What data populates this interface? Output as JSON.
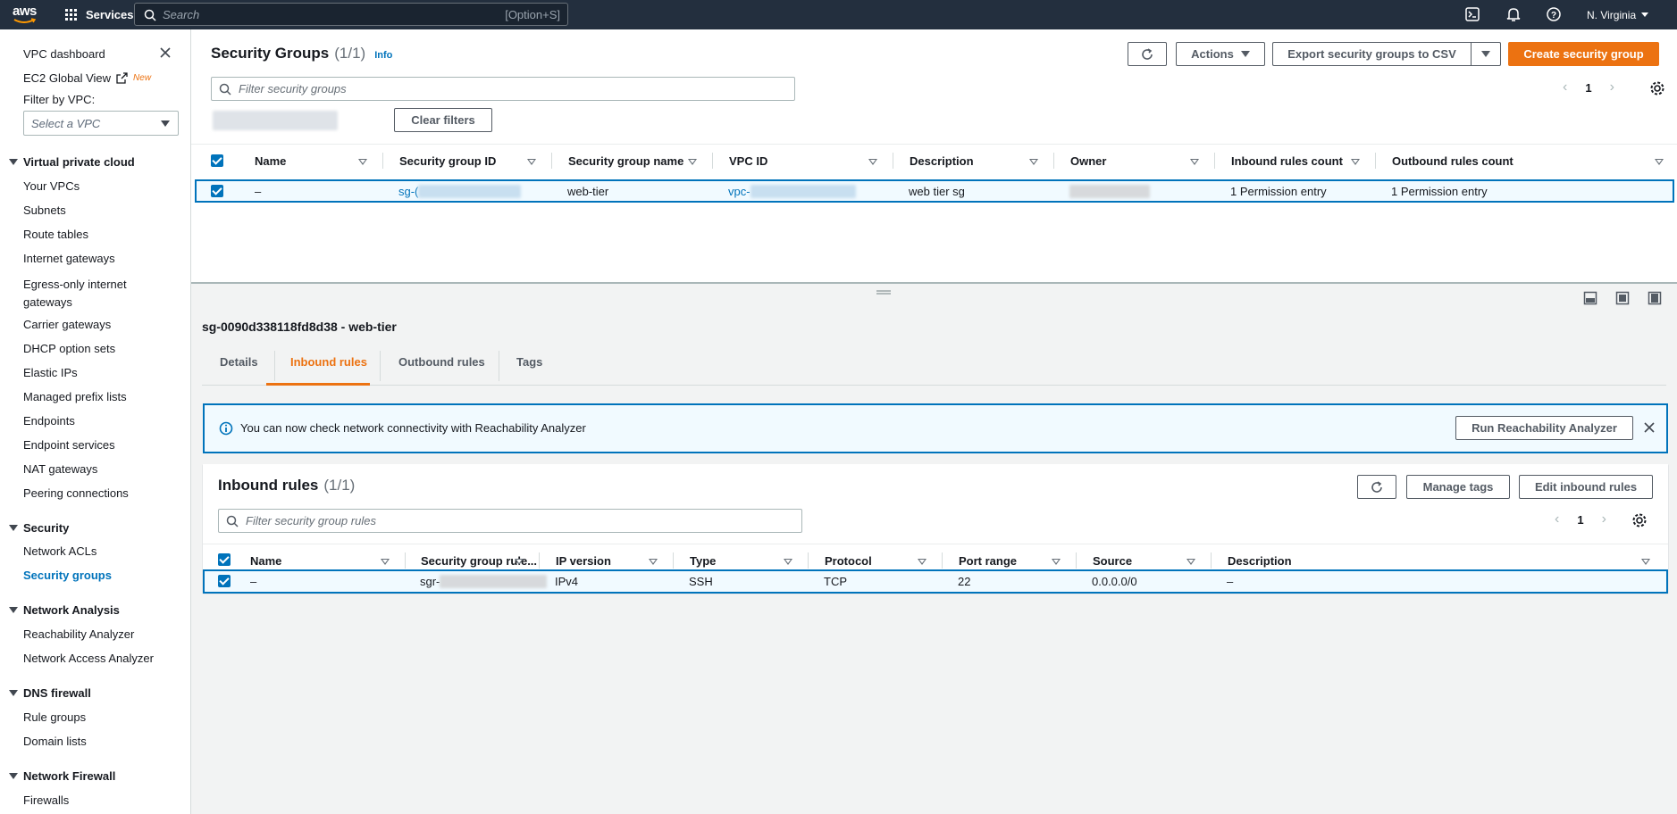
{
  "topnav": {
    "logo_text": "aws",
    "services_label": "Services",
    "search_placeholder": "Search",
    "search_shortcut": "[Option+S]",
    "region": "N. Virginia"
  },
  "sidebar": {
    "vpc_dashboard": "VPC dashboard",
    "ec2_global_view": "EC2 Global View",
    "new_badge": "New",
    "filter_by_vpc": "Filter by VPC:",
    "vpc_select_placeholder": "Select a VPC",
    "sections": [
      {
        "title": "Virtual private cloud",
        "items": [
          "Your VPCs",
          "Subnets",
          "Route tables",
          "Internet gateways",
          "Egress-only internet gateways",
          "Carrier gateways",
          "DHCP option sets",
          "Elastic IPs",
          "Managed prefix lists",
          "Endpoints",
          "Endpoint services",
          "NAT gateways",
          "Peering connections"
        ]
      },
      {
        "title": "Security",
        "items": [
          "Network ACLs",
          "Security groups"
        ]
      },
      {
        "title": "Network Analysis",
        "items": [
          "Reachability Analyzer",
          "Network Access Analyzer"
        ]
      },
      {
        "title": "DNS firewall",
        "items": [
          "Rule groups",
          "Domain lists"
        ]
      },
      {
        "title": "Network Firewall",
        "items": [
          "Firewalls"
        ]
      }
    ],
    "egress_line1": "Egress-only internet",
    "egress_line2": "gateways",
    "active_item": "Security groups"
  },
  "sg_list": {
    "title": "Security Groups",
    "count": "(1/1)",
    "info": "Info",
    "actions_label": "Actions",
    "export_label": "Export security groups to CSV",
    "create_label": "Create security group",
    "filter_placeholder": "Filter security groups",
    "clear_filters": "Clear filters",
    "page": "1",
    "columns": [
      "Name",
      "Security group ID",
      "Security group name",
      "VPC ID",
      "Description",
      "Owner",
      "Inbound rules count",
      "Outbound rules count"
    ],
    "row": {
      "name": "–",
      "sg_id_prefix": "sg-(",
      "sg_name": "web-tier",
      "vpc_prefix": "vpc-",
      "description": "web tier sg",
      "inbound": "1 Permission entry",
      "outbound": "1 Permission entry"
    }
  },
  "detail": {
    "heading": "sg-0090d338118fd8d38 - web-tier",
    "tabs": [
      "Details",
      "Inbound rules",
      "Outbound rules",
      "Tags"
    ],
    "active_tab": "Inbound rules",
    "alert_text": "You can now check network connectivity with Reachability Analyzer",
    "alert_button": "Run Reachability Analyzer"
  },
  "inbound": {
    "title": "Inbound rules",
    "count": "(1/1)",
    "manage_tags": "Manage tags",
    "edit_rules": "Edit inbound rules",
    "filter_placeholder": "Filter security group rules",
    "page": "1",
    "columns": [
      "Name",
      "Security group rule...",
      "IP version",
      "Type",
      "Protocol",
      "Port range",
      "Source",
      "Description"
    ],
    "row": {
      "name": "–",
      "rule_prefix": "sgr-",
      "ip_version": "IPv4",
      "type": "SSH",
      "protocol": "TCP",
      "port_range": "22",
      "source": "0.0.0.0/0",
      "description": "–"
    }
  },
  "colors": {
    "nav": "#232f3e",
    "accent": "#ec7211",
    "link": "#0073bb"
  }
}
